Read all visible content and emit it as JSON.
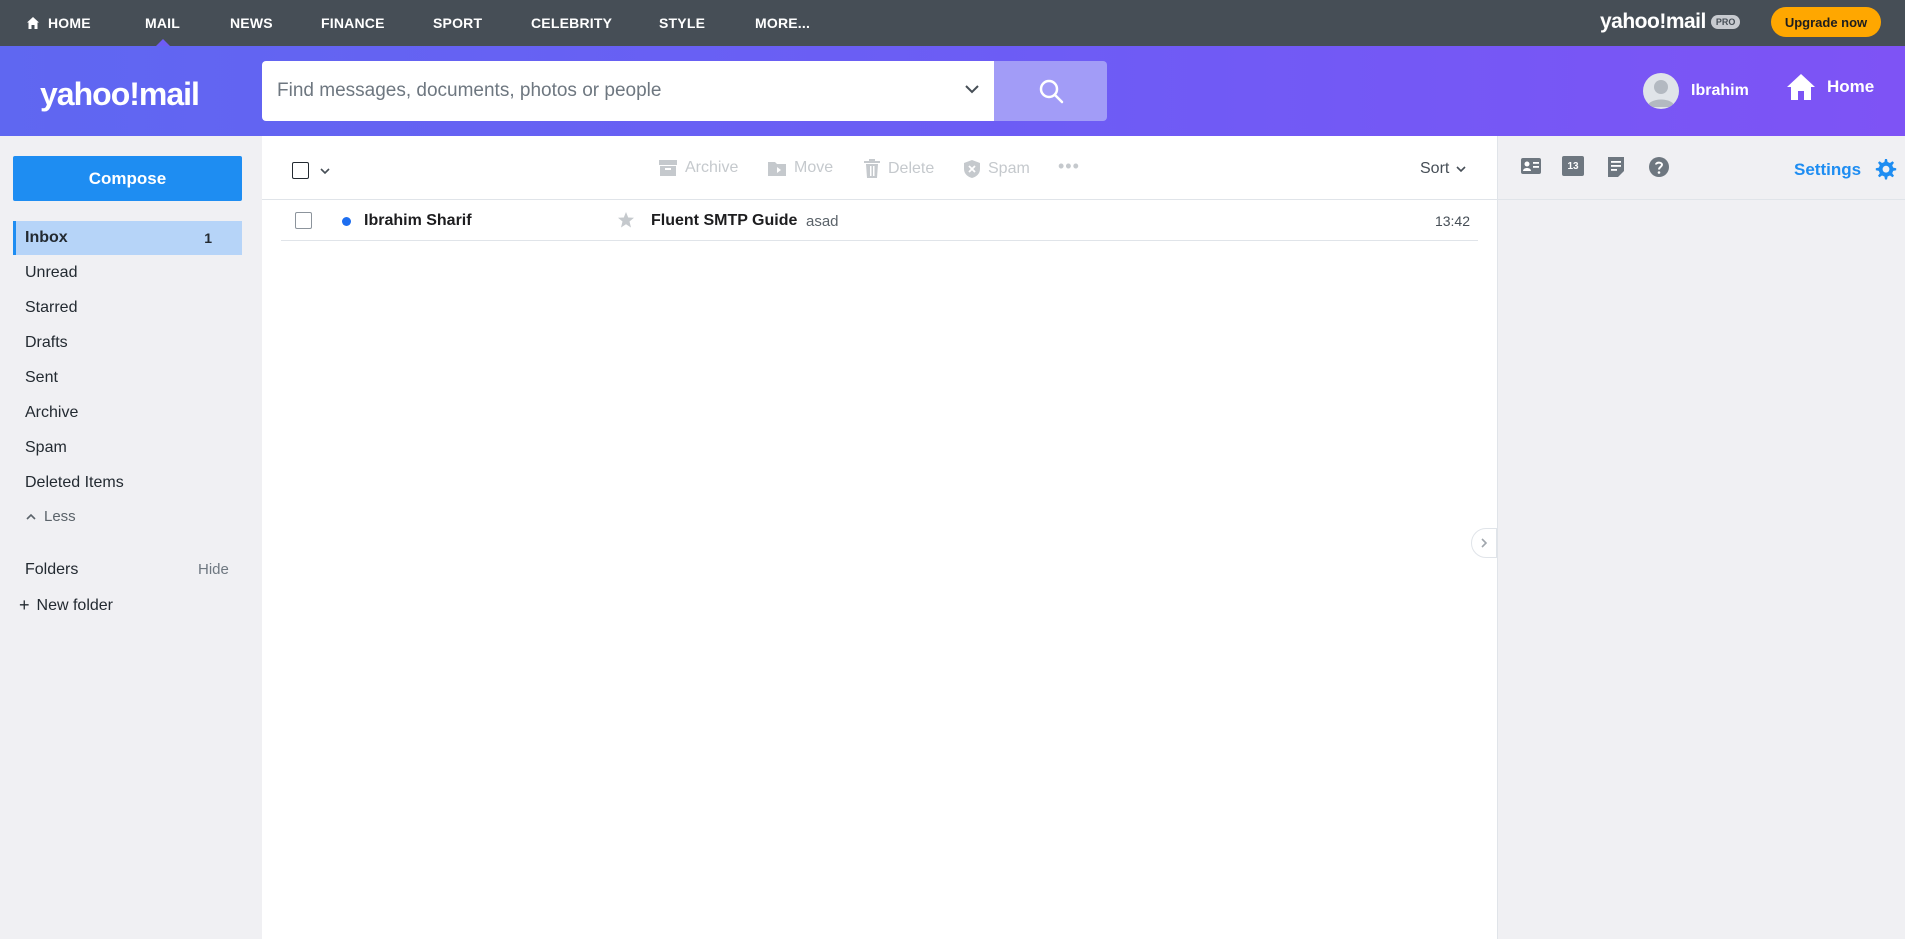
{
  "topnav": {
    "items": [
      {
        "label": "HOME",
        "icon": "home-icon"
      },
      {
        "label": "MAIL",
        "active": true
      },
      {
        "label": "NEWS"
      },
      {
        "label": "FINANCE"
      },
      {
        "label": "SPORT"
      },
      {
        "label": "CELEBRITY"
      },
      {
        "label": "STYLE"
      },
      {
        "label": "MORE..."
      }
    ],
    "brand": "yahoo!mail",
    "brand_badge": "PRO",
    "upgrade_label": "Upgrade now"
  },
  "header": {
    "logo": "yahoo!mail",
    "search_placeholder": "Find messages, documents, photos or people",
    "user_name": "Ibrahim",
    "home_label": "Home"
  },
  "sidebar": {
    "compose_label": "Compose",
    "folders": [
      {
        "label": "Inbox",
        "count": "1",
        "active": true
      },
      {
        "label": "Unread"
      },
      {
        "label": "Starred"
      },
      {
        "label": "Drafts"
      },
      {
        "label": "Sent"
      },
      {
        "label": "Archive"
      },
      {
        "label": "Spam"
      },
      {
        "label": "Deleted Items"
      }
    ],
    "less_label": "Less",
    "folders_header": "Folders",
    "hide_label": "Hide",
    "new_folder_label": "New folder"
  },
  "toolbar": {
    "archive_label": "Archive",
    "move_label": "Move",
    "delete_label": "Delete",
    "spam_label": "Spam",
    "more_label": "•••",
    "sort_label": "Sort"
  },
  "messages": [
    {
      "sender": "Ibrahim Sharif",
      "subject": "Fluent SMTP Guide",
      "snippet": "asad",
      "time": "13:42",
      "unread": true
    }
  ],
  "right_panel": {
    "calendar_day": "13",
    "settings_label": "Settings"
  },
  "colors": {
    "accent": "#1e8df2",
    "header_start": "#5f67f1",
    "header_end": "#7e53f5",
    "topnav_bg": "#464e56",
    "upgrade": "#ffa700"
  }
}
